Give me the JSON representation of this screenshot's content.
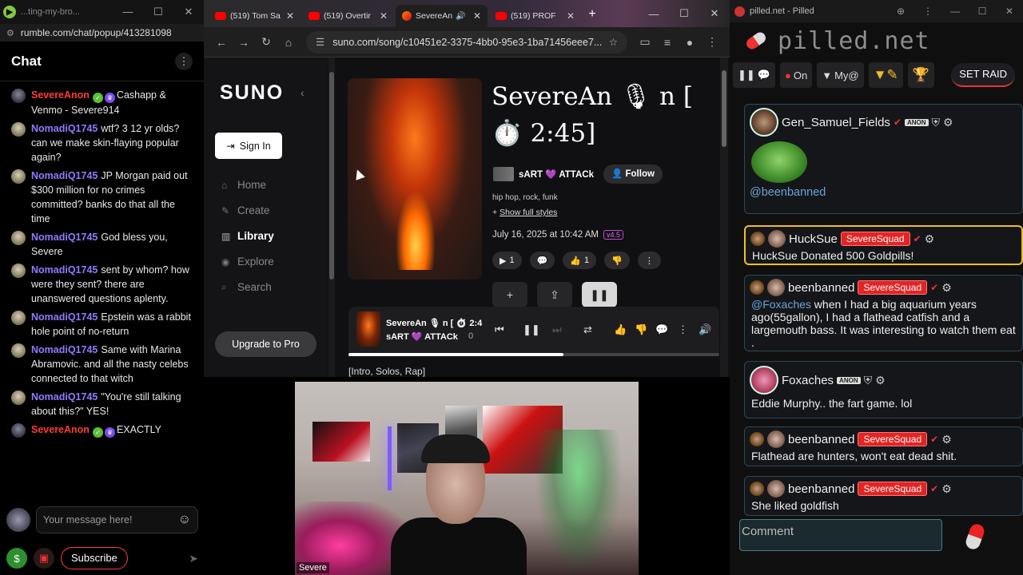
{
  "rumble": {
    "window_title": "...ting-my-bro...",
    "url": "rumble.com/chat/popup/413281098",
    "chat_title": "Chat",
    "messages": [
      {
        "user": "SevereAnon",
        "text": "Cashapp & Venmo - Severe914",
        "color": "#ff3b3b",
        "badges": true
      },
      {
        "user": "NomadiQ1745",
        "text": "wtf? 3 12 yr olds? can we make skin-flaying popular again?",
        "color": "#8f7bff",
        "badges": false
      },
      {
        "user": "NomadiQ1745",
        "text": "JP Morgan paid out $300 million for no crimes committed? banks do that all the time",
        "color": "#8f7bff",
        "badges": false
      },
      {
        "user": "NomadiQ1745",
        "text": "God bless you, Severe",
        "color": "#8f7bff",
        "badges": false
      },
      {
        "user": "NomadiQ1745",
        "text": "sent by whom? how were they sent? there are unanswered questions aplenty.",
        "color": "#8f7bff",
        "badges": false
      },
      {
        "user": "NomadiQ1745",
        "text": "Epstein was a rabbit hole point of no-return",
        "color": "#8f7bff",
        "badges": false
      },
      {
        "user": "NomadiQ1745",
        "text": "Same with Marina Abramovic. and all the nasty celebs connected to that witch",
        "color": "#8f7bff",
        "badges": false
      },
      {
        "user": "NomadiQ1745",
        "text": "\"You're still talking about this?\" YES!",
        "color": "#8f7bff",
        "badges": false
      },
      {
        "user": "SevereAnon",
        "text": "EXACTLY",
        "color": "#ff3b3b",
        "badges": true
      }
    ],
    "input_placeholder": "Your message here!",
    "subscribe_label": "Subscribe"
  },
  "browser": {
    "tabs": [
      {
        "title": "(519) Tom Sa",
        "kind": "yt",
        "active": false
      },
      {
        "title": "(519) Overtir",
        "kind": "yt",
        "active": false
      },
      {
        "title": "SevereAn",
        "kind": "suno",
        "active": true
      },
      {
        "title": "(519) PROF",
        "kind": "yt",
        "active": false
      }
    ],
    "url": "suno.com/song/c10451e2-3375-4bb0-95e3-1ba71456eee7..."
  },
  "suno": {
    "logo": "SUNO",
    "sign_in": "Sign In",
    "nav": [
      {
        "label": "Home",
        "icon": "home-icon",
        "selected": false
      },
      {
        "label": "Create",
        "icon": "create-icon",
        "selected": false
      },
      {
        "label": "Library",
        "icon": "library-icon",
        "selected": true
      },
      {
        "label": "Explore",
        "icon": "explore-icon",
        "selected": false
      },
      {
        "label": "Search",
        "icon": "search-icon",
        "selected": false
      }
    ],
    "upgrade": "Upgrade to Pro",
    "song_title": "SevereAn 🎙 n [ ⏱️ 2:45]",
    "artist": "sART 💜 ATTACk",
    "follow": "Follow",
    "styles": "hip hop, rock, funk",
    "show_styles": "Show full styles",
    "date": "July 16, 2025 at 10:42 AM",
    "version": "v4.5",
    "plays": "1",
    "likes": "1",
    "player_title": "SevereAn 🎙 n [ ⏱ 2:4",
    "player_artist": "sART 💜 ATTACk",
    "player_count": "0",
    "progress": 0.58,
    "lyrics_first": "[Intro, Solos, Rap]"
  },
  "webcam": {
    "label": "Severe"
  },
  "pilled": {
    "window_title": "pilled.net - Pilled",
    "brand": "pilled.net",
    "nav_on": "On",
    "nav_my": "My@",
    "set_raid": "SET RAID",
    "posts": [
      {
        "user": "Gen_Samuel_Fields",
        "badge": "",
        "text": "@beenbanned",
        "frog": true
      },
      {
        "user": "HuckSue",
        "badge": "SevereSquad",
        "text": "HuckSue Donated 500 Goldpills!",
        "gold": true
      },
      {
        "user": "beenbanned",
        "badge": "SevereSquad",
        "mention": "@Foxaches",
        "text": " when I had a big aquarium years ago(55gallon), I had a flathead catfish and a largemouth bass. It was interesting to watch them eat ."
      },
      {
        "user": "Foxaches",
        "badge": "",
        "text": "Eddie Murphy.. the fart game. lol"
      },
      {
        "user": "beenbanned",
        "badge": "SevereSquad",
        "text": "Flathead are hunters, won't eat dead shit."
      },
      {
        "user": "beenbanned",
        "badge": "SevereSquad",
        "text": "She liked goldfish"
      }
    ],
    "comment_placeholder": "Comment"
  }
}
